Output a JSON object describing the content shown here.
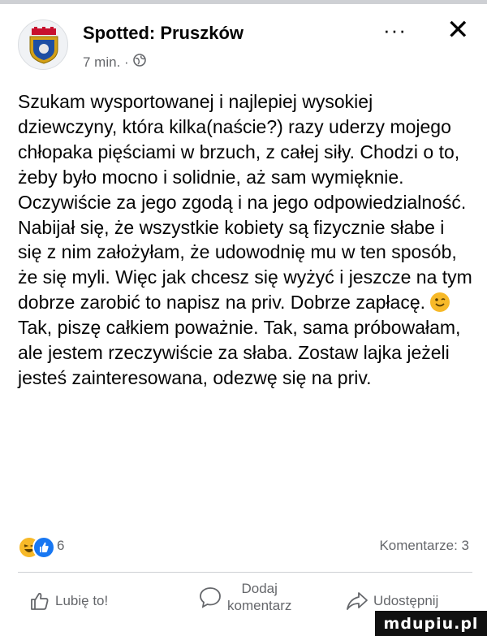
{
  "header": {
    "page_name": "Spotted: Pruszków",
    "time_ago": "7 min. ·",
    "more_label": "···",
    "close_label": "✕"
  },
  "post": {
    "paragraph1": "Szukam wysportowanej i najlepiej wysokiej dziewczyny, która kilka(naście?) razy uderzy mojego chłopaka pięściami w brzuch, z całej siły. Chodzi o to, żeby było mocno i solidnie, aż sam wymięknie. Oczywiście za jego zgodą i na jego odpowiedzialność. Nabijał się, że wszystkie kobiety są fizycznie słabe i się z nim założyłam, że udowodnię mu w ten sposób, że się myli. Więc jak chcesz się wyżyć i jeszcze na tym dobrze zarobić to napisz na priv. Dobrze zapłacę.",
    "paragraph2": "Tak, piszę całkiem poważnie. Tak, sama próbowałam, ale jestem rzeczywiście za słaba. Zostaw lajka jeżeli jesteś zainteresowana, odezwę się na priv."
  },
  "reactions": {
    "count": "6",
    "comments": "Komentarze: 3"
  },
  "actions": {
    "like_label": "Lubię to!",
    "comment_label_line1": "Dodaj",
    "comment_label_line2": "komentarz",
    "share_label": "Udostępnij"
  },
  "watermark": "mdupiu.pl",
  "colors": {
    "text": "#050505",
    "secondary": "#65676b",
    "like_blue": "#1877f2",
    "haha_yellow": "#f7b928",
    "divider": "#ced0d4"
  },
  "icons": [
    "coat-of-arms-icon",
    "globe-icon",
    "more-icon",
    "close-icon",
    "haha-reaction-icon",
    "like-reaction-icon",
    "thumbs-up-icon",
    "comment-bubble-icon",
    "share-arrow-icon",
    "wink-emoji-icon"
  ]
}
